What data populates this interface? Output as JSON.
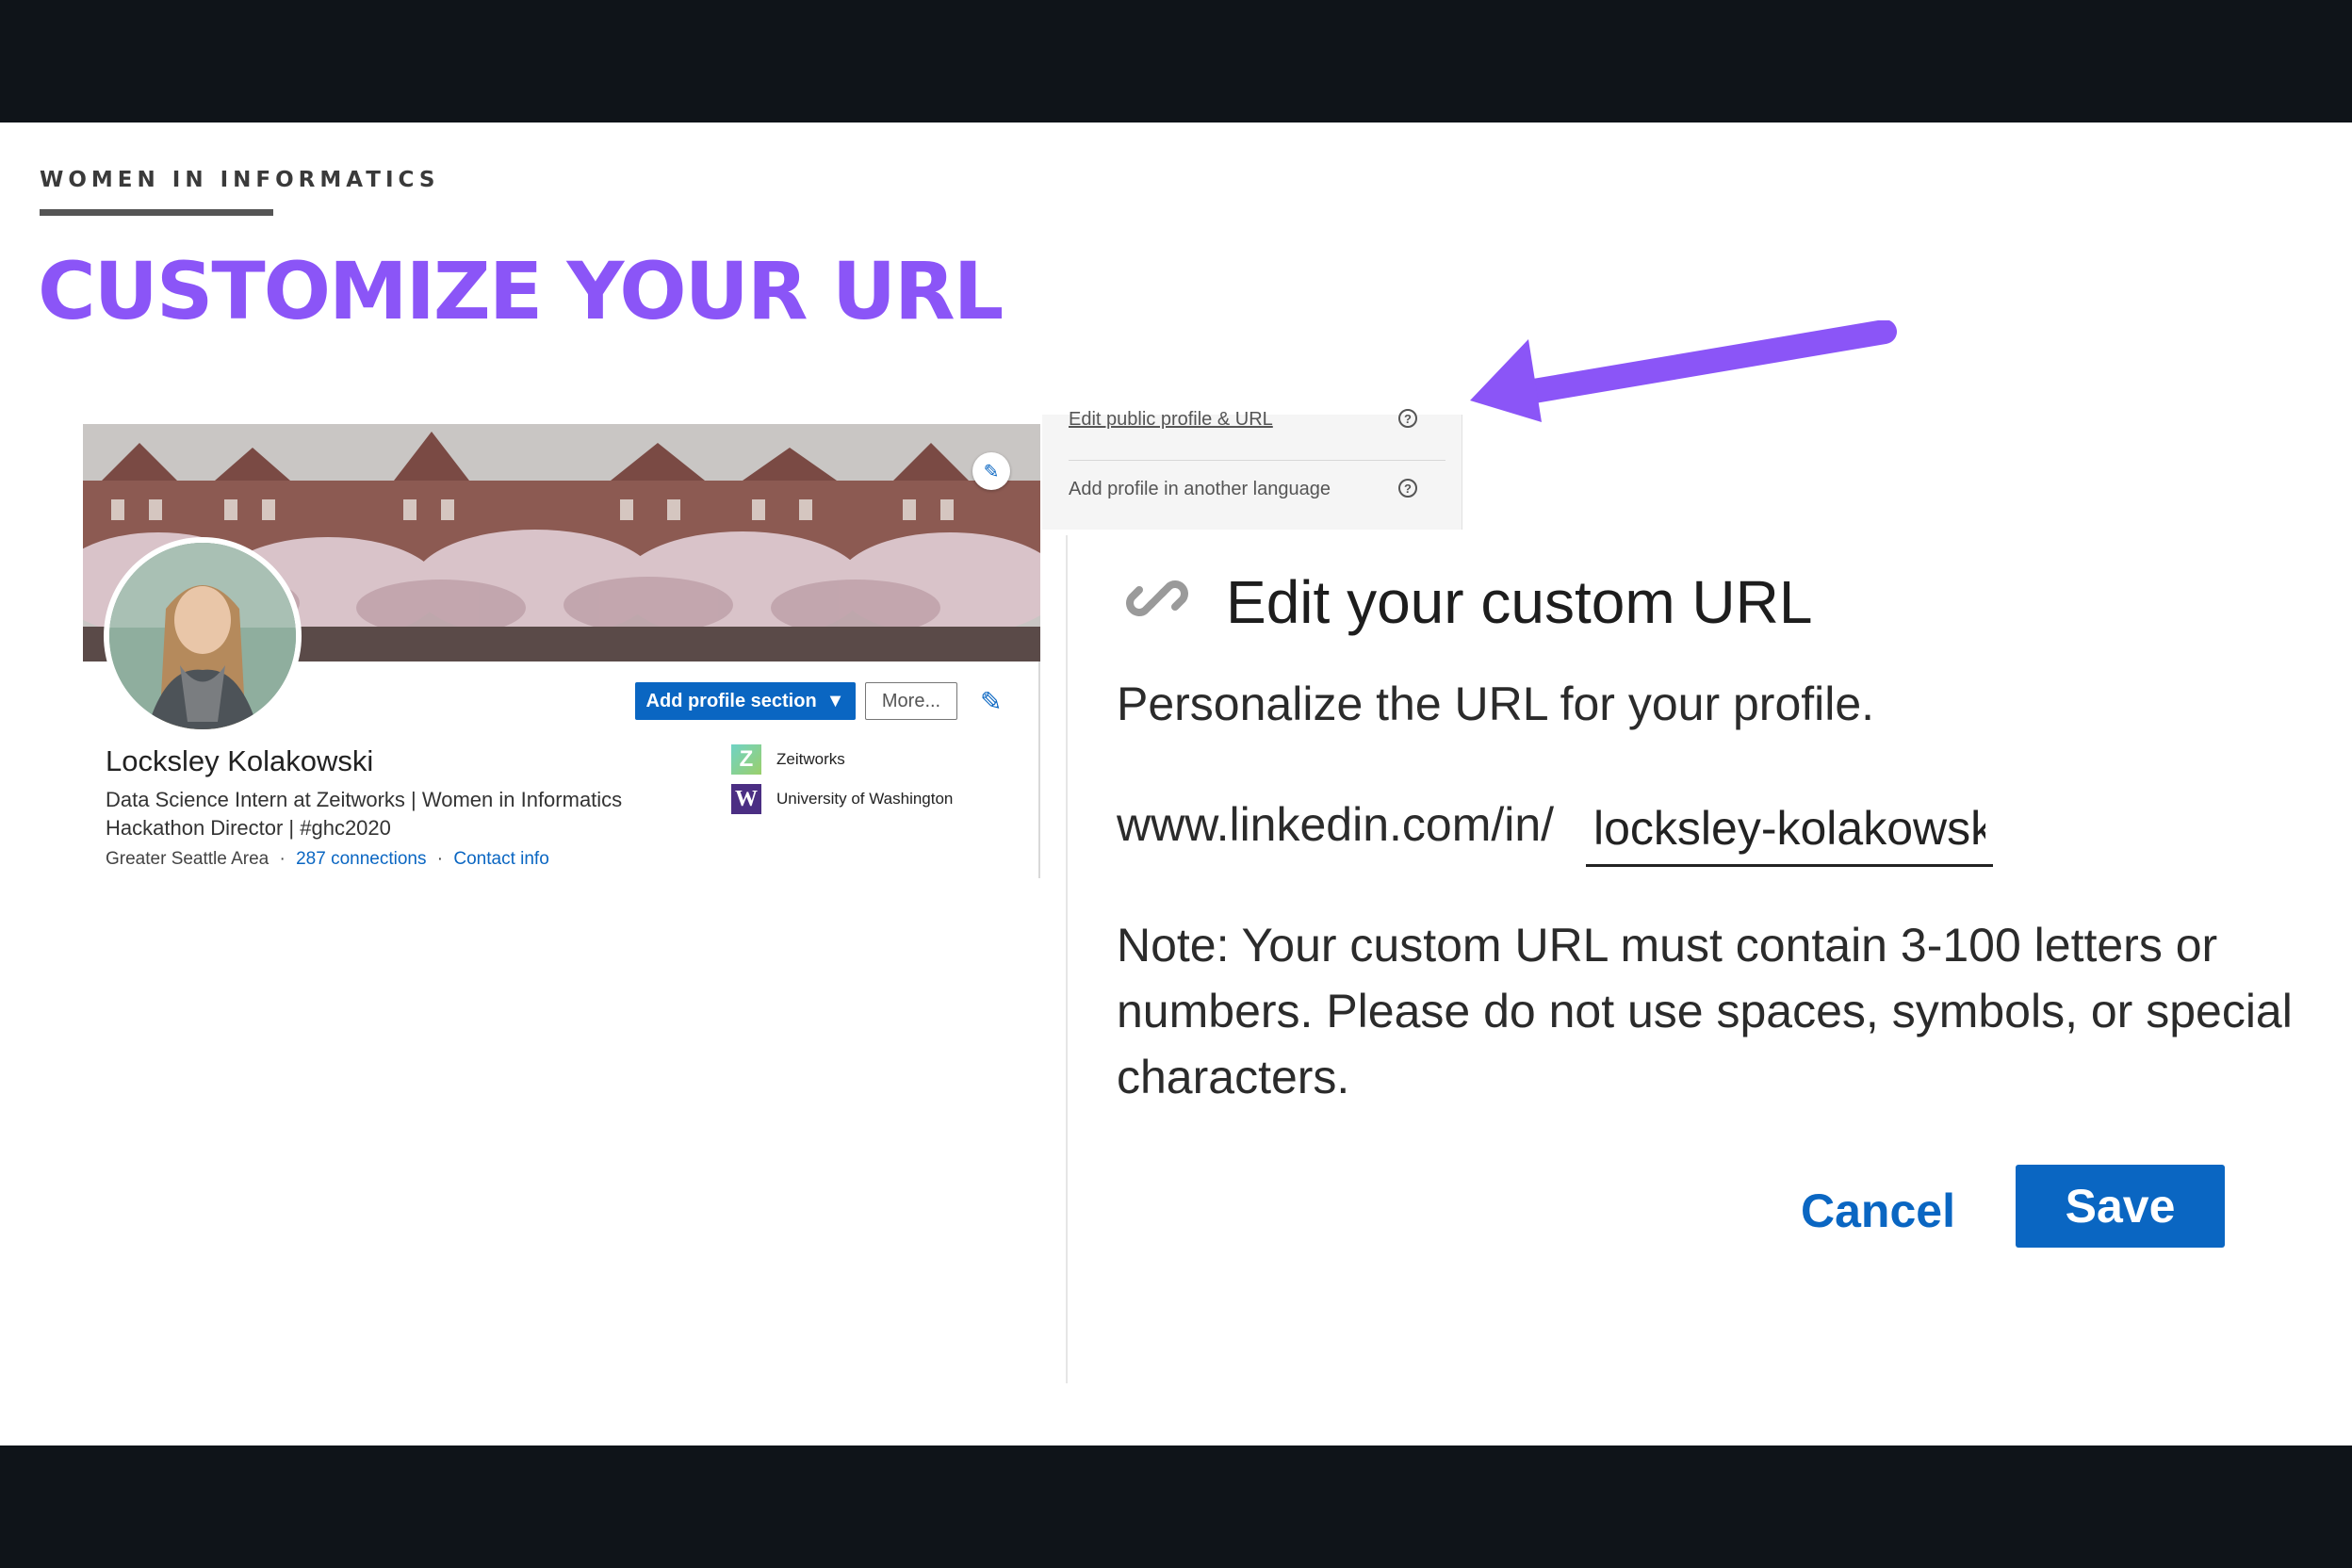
{
  "slide": {
    "kicker": "WOMEN IN INFORMATICS",
    "title": "CUSTOMIZE YOUR URL",
    "accent_color": "#8b55f7"
  },
  "profile": {
    "name": "Locksley Kolakowski",
    "headline": "Data Science Intern at Zeitworks | Women in Informatics Hackathon Director | #ghc2020",
    "location": "Greater Seattle Area",
    "separator": "·",
    "connections": "287 connections",
    "contact_info": "Contact info",
    "add_section_label": "Add profile section",
    "more_label": "More...",
    "orgs": [
      {
        "name": "Zeitworks",
        "logo": "Z"
      },
      {
        "name": "University of Washington",
        "logo": "W"
      }
    ]
  },
  "side_menu": {
    "items": [
      {
        "label": "Edit public profile & URL",
        "help": "?"
      },
      {
        "label": "Add profile in another language",
        "help": "?"
      }
    ]
  },
  "dialog": {
    "icon": "link-icon",
    "title": "Edit your custom URL",
    "subtitle": "Personalize the URL for your profile.",
    "url_prefix": "www.linkedin.com/in/",
    "url_value": "locksley-kolakowsk",
    "note": "Note: Your custom URL must contain 3-100 letters or numbers. Please do not use spaces, symbols, or special characters.",
    "cancel_label": "Cancel",
    "save_label": "Save",
    "brand_color": "#0a66c2"
  }
}
